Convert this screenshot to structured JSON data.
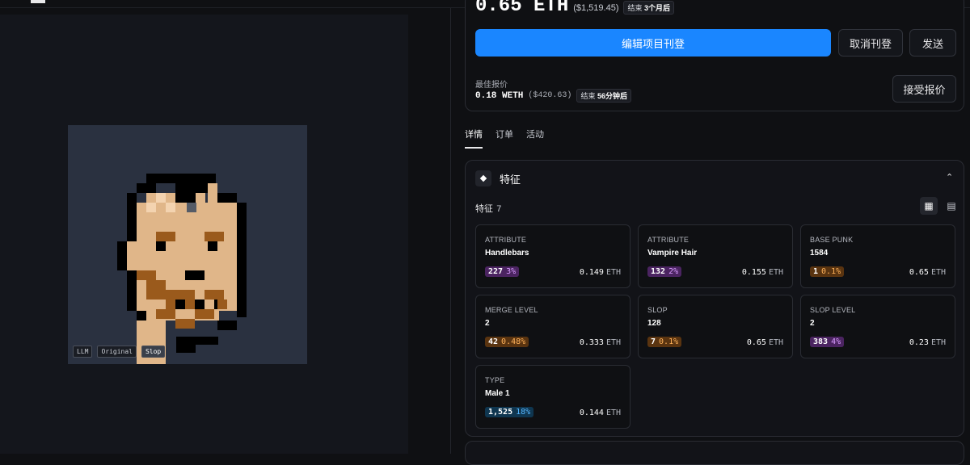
{
  "listing": {
    "price": "0.65 ETH",
    "usd": "($1,519.45)",
    "ends_label": "结束",
    "ends_value": "3个月后",
    "edit_button": "编辑项目刊登",
    "cancel_button": "取消刊登",
    "send_button": "发送"
  },
  "best_offer": {
    "label": "最佳报价",
    "value": "0.18 WETH",
    "usd": "($420.63)",
    "ends_label": "结束",
    "ends_value": "56分钟后",
    "accept_button": "接受报价"
  },
  "tabs": [
    "详情",
    "订单",
    "活动"
  ],
  "traits": {
    "title": "特征",
    "count_label": "特征",
    "count": "7",
    "items": [
      {
        "key": "ATTRIBUTE",
        "value": "Handlebars",
        "count": "227",
        "pct": "3%",
        "color": "purple",
        "price": "0.149",
        "unit": "ETH"
      },
      {
        "key": "ATTRIBUTE",
        "value": "Vampire Hair",
        "count": "132",
        "pct": "2%",
        "color": "purple",
        "price": "0.155",
        "unit": "ETH"
      },
      {
        "key": "BASE PUNK",
        "value": "1584",
        "count": "1",
        "pct": "0.1%",
        "color": "orange",
        "price": "0.65",
        "unit": "ETH"
      },
      {
        "key": "MERGE LEVEL",
        "value": "2",
        "count": "42",
        "pct": "0.48%",
        "color": "orange",
        "price": "0.333",
        "unit": "ETH"
      },
      {
        "key": "SLOP",
        "value": "128",
        "count": "7",
        "pct": "0.1%",
        "color": "orange",
        "price": "0.65",
        "unit": "ETH"
      },
      {
        "key": "SLOP LEVEL",
        "value": "2",
        "count": "383",
        "pct": "4%",
        "color": "purple",
        "price": "0.23",
        "unit": "ETH"
      },
      {
        "key": "TYPE",
        "value": "Male 1",
        "count": "1,525",
        "pct": "18%",
        "color": "blue",
        "price": "0.144",
        "unit": "ETH"
      }
    ]
  },
  "image_tags": [
    "LLM",
    "Original",
    "Slop"
  ],
  "icons": {
    "trait_section": "diamond-icon",
    "collapse": "chevron-up-icon",
    "grid_view": "grid-icon",
    "list_view": "list-icon"
  }
}
